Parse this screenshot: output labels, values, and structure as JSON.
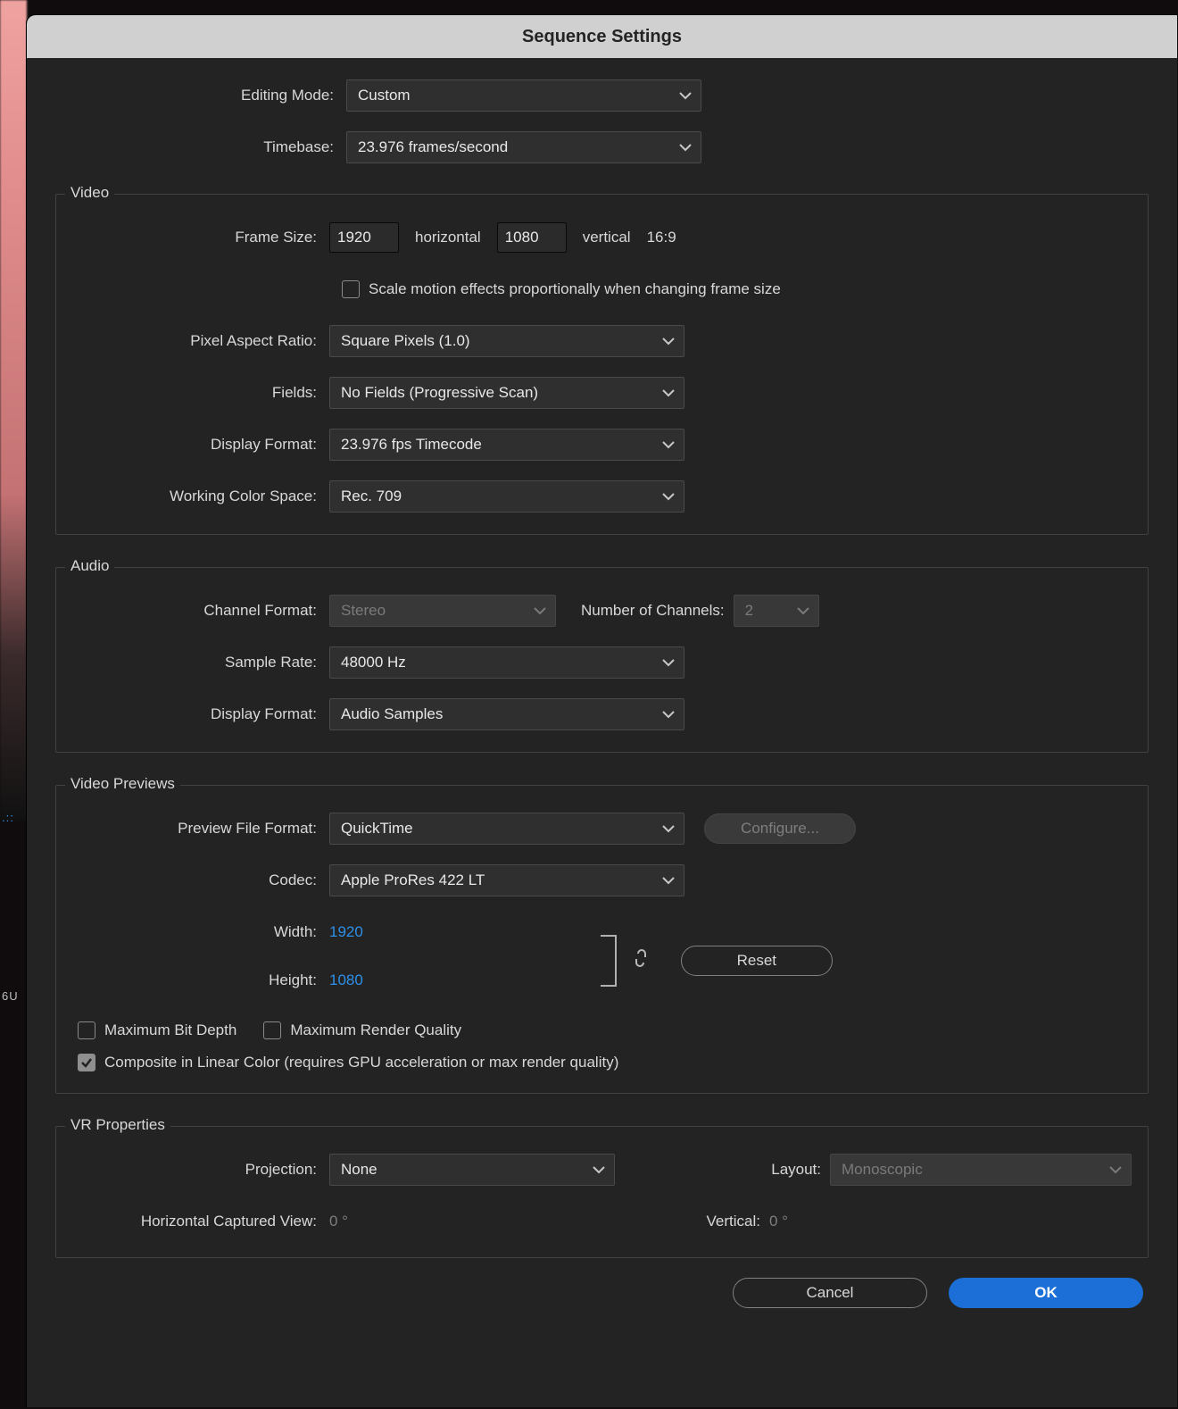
{
  "dialog": {
    "title": "Sequence Settings",
    "editing_mode_label": "Editing Mode:",
    "editing_mode_value": "Custom",
    "timebase_label": "Timebase:",
    "timebase_value": "23.976  frames/second"
  },
  "video": {
    "legend": "Video",
    "frame_size_label": "Frame Size:",
    "width": "1920",
    "height": "1080",
    "horizontal": "horizontal",
    "vertical": "vertical",
    "aspect": "16:9",
    "scale_motion": "Scale motion effects proportionally when changing frame size",
    "par_label": "Pixel Aspect Ratio:",
    "par_value": "Square Pixels (1.0)",
    "fields_label": "Fields:",
    "fields_value": "No Fields (Progressive Scan)",
    "display_format_label": "Display Format:",
    "display_format_value": "23.976 fps Timecode",
    "color_space_label": "Working Color Space:",
    "color_space_value": "Rec. 709"
  },
  "audio": {
    "legend": "Audio",
    "channel_format_label": "Channel Format:",
    "channel_format_value": "Stereo",
    "num_channels_label": "Number of Channels:",
    "num_channels_value": "2",
    "sample_rate_label": "Sample Rate:",
    "sample_rate_value": "48000 Hz",
    "display_format_label": "Display Format:",
    "display_format_value": "Audio Samples"
  },
  "previews": {
    "legend": "Video Previews",
    "file_format_label": "Preview File Format:",
    "file_format_value": "QuickTime",
    "configure": "Configure...",
    "codec_label": "Codec:",
    "codec_value": "Apple ProRes 422 LT",
    "width_label": "Width:",
    "width_value": "1920",
    "height_label": "Height:",
    "height_value": "1080",
    "reset": "Reset",
    "max_bit_depth": "Maximum Bit Depth",
    "max_render_quality": "Maximum Render Quality",
    "composite_linear": "Composite in Linear Color (requires GPU acceleration or max render quality)"
  },
  "vr": {
    "legend": "VR Properties",
    "projection_label": "Projection:",
    "projection_value": "None",
    "layout_label": "Layout:",
    "layout_value": "Monoscopic",
    "hcv_label": "Horizontal Captured View:",
    "hcv_value": "0 °",
    "vert_label": "Vertical:",
    "vert_value": "0 °"
  },
  "footer": {
    "cancel": "Cancel",
    "ok": "OK"
  },
  "misc": {
    "left1": ".::",
    "left2": "6U"
  }
}
